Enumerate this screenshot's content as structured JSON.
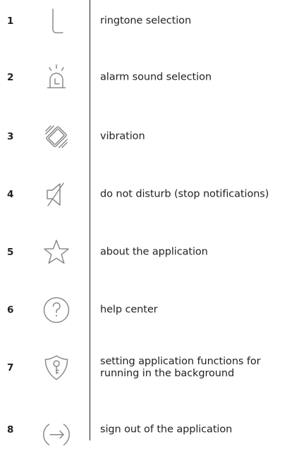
{
  "rows": [
    {
      "number": "1",
      "icon": "music-note-icon",
      "label": "ringtone selection"
    },
    {
      "number": "2",
      "icon": "alarm-icon",
      "label": "alarm sound selection"
    },
    {
      "number": "3",
      "icon": "vibration-icon",
      "label": "vibration"
    },
    {
      "number": "4",
      "icon": "do-not-disturb-icon",
      "label": "do not disturb (stop notifications)"
    },
    {
      "number": "5",
      "icon": "star-icon",
      "label": "about the application"
    },
    {
      "number": "6",
      "icon": "help-icon",
      "label": "help center"
    },
    {
      "number": "7",
      "icon": "shield-key-icon",
      "label": "setting application functions for\nrunning in the background"
    },
    {
      "number": "8",
      "icon": "sign-out-icon",
      "label": "sign out of the application"
    }
  ],
  "colors": {
    "text": "#231f20",
    "icon_stroke": "#8a8a8a",
    "divider": "#231f20"
  }
}
